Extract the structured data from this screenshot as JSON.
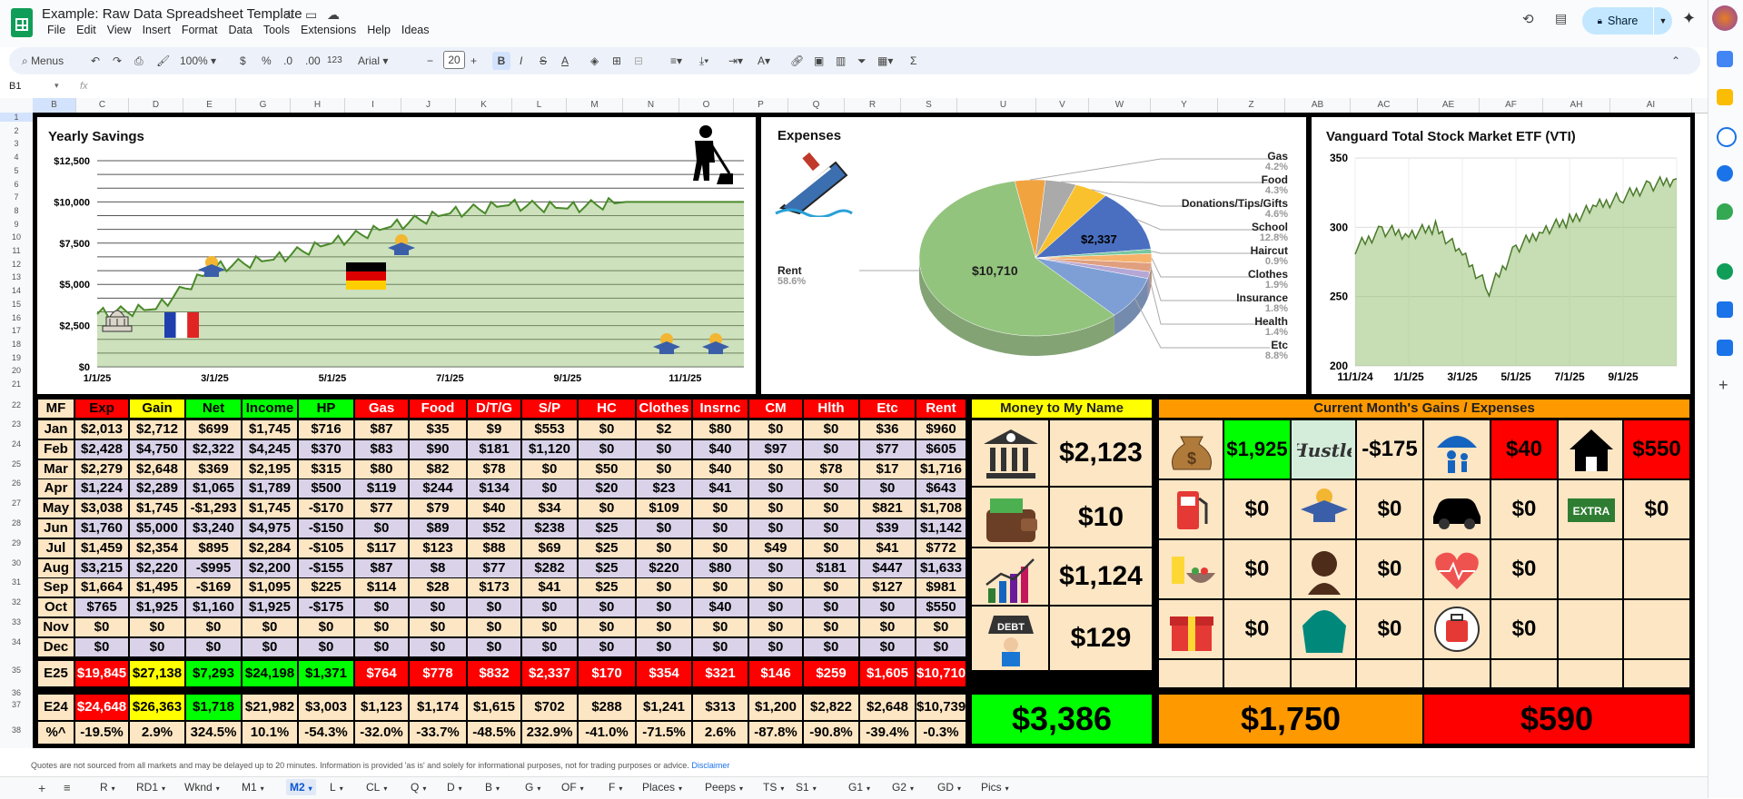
{
  "app": {
    "title": "Example: Raw Data Spreadsheet Template",
    "menus": [
      "File",
      "Edit",
      "View",
      "Insert",
      "Format",
      "Data",
      "Tools",
      "Extensions",
      "Help",
      "Ideas"
    ],
    "share_label": "Share",
    "cell_ref": "B1",
    "fx": "fx"
  },
  "toolbar": {
    "search_label": "Menus",
    "zoom": "100%",
    "currency": "$",
    "percent": "%",
    "dec_less": ".0",
    "dec_more": ".00",
    "num_format": "123",
    "font": "Arial",
    "font_size": "20",
    "bold": "B",
    "italic": "I",
    "strike": "S",
    "text_color": "A"
  },
  "columns": [
    "B",
    "C",
    "D",
    "E",
    "G",
    "H",
    "I",
    "J",
    "K",
    "L",
    "M",
    "N",
    "O",
    "P",
    "Q",
    "R",
    "S",
    "U",
    "V",
    "W",
    "Y",
    "Z",
    "AB",
    "AC",
    "AE",
    "AF",
    "AH",
    "AI"
  ],
  "rows": [
    "1",
    "2",
    "3",
    "4",
    "5",
    "6",
    "7",
    "8",
    "9",
    "10",
    "11",
    "12",
    "13",
    "14",
    "15",
    "16",
    "17",
    "18",
    "19",
    "20",
    "21",
    "22",
    "23",
    "24",
    "25",
    "26",
    "27",
    "28",
    "29",
    "30",
    "31",
    "32",
    "33",
    "34",
    "35",
    "36",
    "37",
    "38"
  ],
  "savings_chart": {
    "title": "Yearly Savings",
    "y_ticks": [
      "$0",
      "$2,500",
      "$5,000",
      "$7,500",
      "$10,000",
      "$12,500"
    ],
    "x_ticks": [
      "1/1/25",
      "3/1/25",
      "5/1/25",
      "7/1/25",
      "9/1/25",
      "11/1/25"
    ]
  },
  "expenses_chart": {
    "title": "Expenses",
    "rent_label": "Rent",
    "rent_pct": "58.6%",
    "rent_value": "$10,710",
    "school_value": "$2,337",
    "legend": [
      {
        "name": "Gas",
        "pct": "4.2%"
      },
      {
        "name": "Food",
        "pct": "4.3%"
      },
      {
        "name": "Donations/Tips/Gifts",
        "pct": "4.6%"
      },
      {
        "name": "School",
        "pct": "12.8%"
      },
      {
        "name": "Haircut",
        "pct": "0.9%"
      },
      {
        "name": "Clothes",
        "pct": "1.9%"
      },
      {
        "name": "Insurance",
        "pct": "1.8%"
      },
      {
        "name": "Health",
        "pct": "1.4%"
      },
      {
        "name": "Etc",
        "pct": "8.8%"
      }
    ]
  },
  "vti_chart": {
    "title": "Vanguard Total Stock Market ETF (VTI)",
    "y_ticks": [
      "200",
      "250",
      "300",
      "350"
    ],
    "x_ticks": [
      "11/1/24",
      "1/1/25",
      "3/1/25",
      "5/1/25",
      "7/1/25",
      "9/1/25"
    ]
  },
  "chart_data": [
    {
      "type": "area",
      "title": "Yearly Savings",
      "x": [
        "1/1/25",
        "2/1/25",
        "3/1/25",
        "4/1/25",
        "5/1/25",
        "6/1/25",
        "7/1/25",
        "8/1/25",
        "9/1/25",
        "10/1/25",
        "11/1/25",
        "12/1/25"
      ],
      "values": [
        3200,
        3500,
        6000,
        6500,
        7500,
        8500,
        9300,
        9800,
        9600,
        10000,
        10000,
        10000
      ],
      "ylim": [
        0,
        12500
      ]
    },
    {
      "type": "pie",
      "title": "Expenses",
      "categories": [
        "Rent",
        "Gas",
        "Food",
        "Donations/Tips/Gifts",
        "School",
        "Haircut",
        "Clothes",
        "Insurance",
        "Health",
        "Etc"
      ],
      "values": [
        58.6,
        4.2,
        4.3,
        4.6,
        12.8,
        0.9,
        1.9,
        1.8,
        1.4,
        8.8
      ]
    },
    {
      "type": "area",
      "title": "Vanguard Total Stock Market ETF (VTI)",
      "x": [
        "11/1/24",
        "12/1/24",
        "1/1/25",
        "2/1/25",
        "3/1/25",
        "4/1/25",
        "5/1/25",
        "6/1/25",
        "7/1/25",
        "8/1/25",
        "9/1/25",
        "10/1/25",
        "11/1/25"
      ],
      "values": [
        285,
        298,
        295,
        300,
        280,
        255,
        285,
        298,
        305,
        315,
        322,
        330,
        335
      ],
      "ylim": [
        200,
        350
      ]
    }
  ],
  "table": {
    "headers": [
      "MF",
      "Exp",
      "Gain",
      "Net",
      "Income",
      "HP",
      "Gas",
      "Food",
      "D/T/G",
      "S/P",
      "HC",
      "Clothes",
      "Insrnc",
      "CM",
      "Hlth",
      "Etc",
      "Rent"
    ],
    "rows": [
      [
        "Jan",
        "$2,013",
        "$2,712",
        "$699",
        "$1,745",
        "$716",
        "$87",
        "$35",
        "$9",
        "$553",
        "$0",
        "$2",
        "$80",
        "$0",
        "$0",
        "$36",
        "$960"
      ],
      [
        "Feb",
        "$2,428",
        "$4,750",
        "$2,322",
        "$4,245",
        "$370",
        "$83",
        "$90",
        "$181",
        "$1,120",
        "$0",
        "$0",
        "$40",
        "$97",
        "$0",
        "$77",
        "$605"
      ],
      [
        "Mar",
        "$2,279",
        "$2,648",
        "$369",
        "$2,195",
        "$315",
        "$80",
        "$82",
        "$78",
        "$0",
        "$50",
        "$0",
        "$40",
        "$0",
        "$78",
        "$17",
        "$1,716"
      ],
      [
        "Apr",
        "$1,224",
        "$2,289",
        "$1,065",
        "$1,789",
        "$500",
        "$119",
        "$244",
        "$134",
        "$0",
        "$20",
        "$23",
        "$41",
        "$0",
        "$0",
        "$0",
        "$643"
      ],
      [
        "May",
        "$3,038",
        "$1,745",
        "-$1,293",
        "$1,745",
        "-$170",
        "$77",
        "$79",
        "$40",
        "$34",
        "$0",
        "$109",
        "$0",
        "$0",
        "$0",
        "$821",
        "$1,708"
      ],
      [
        "Jun",
        "$1,760",
        "$5,000",
        "$3,240",
        "$4,975",
        "-$150",
        "$0",
        "$89",
        "$52",
        "$238",
        "$25",
        "$0",
        "$0",
        "$0",
        "$0",
        "$39",
        "$1,142"
      ],
      [
        "Jul",
        "$1,459",
        "$2,354",
        "$895",
        "$2,284",
        "-$105",
        "$117",
        "$123",
        "$88",
        "$69",
        "$25",
        "$0",
        "$0",
        "$49",
        "$0",
        "$41",
        "$772"
      ],
      [
        "Aug",
        "$3,215",
        "$2,220",
        "-$995",
        "$2,200",
        "-$155",
        "$87",
        "$8",
        "$77",
        "$282",
        "$25",
        "$220",
        "$80",
        "$0",
        "$181",
        "$447",
        "$1,633"
      ],
      [
        "Sep",
        "$1,664",
        "$1,495",
        "-$169",
        "$1,095",
        "$225",
        "$114",
        "$28",
        "$173",
        "$41",
        "$25",
        "$0",
        "$0",
        "$0",
        "$0",
        "$127",
        "$981"
      ],
      [
        "Oct",
        "$765",
        "$1,925",
        "$1,160",
        "$1,925",
        "-$175",
        "$0",
        "$0",
        "$0",
        "$0",
        "$0",
        "$0",
        "$40",
        "$0",
        "$0",
        "$0",
        "$550"
      ],
      [
        "Nov",
        "$0",
        "$0",
        "$0",
        "$0",
        "$0",
        "$0",
        "$0",
        "$0",
        "$0",
        "$0",
        "$0",
        "$0",
        "$0",
        "$0",
        "$0",
        "$0"
      ],
      [
        "Dec",
        "$0",
        "$0",
        "$0",
        "$0",
        "$0",
        "$0",
        "$0",
        "$0",
        "$0",
        "$0",
        "$0",
        "$0",
        "$0",
        "$0",
        "$0",
        "$0"
      ]
    ],
    "e25": [
      "E25",
      "$19,845",
      "$27,138",
      "$7,293",
      "$24,198",
      "$1,371",
      "$764",
      "$778",
      "$832",
      "$2,337",
      "$170",
      "$354",
      "$321",
      "$146",
      "$259",
      "$1,605",
      "$10,710"
    ],
    "e24": [
      "E24",
      "$24,648",
      "$26,363",
      "$1,718",
      "$21,982",
      "$3,003",
      "$1,123",
      "$1,174",
      "$1,615",
      "$702",
      "$288",
      "$1,241",
      "$313",
      "$1,200",
      "$2,822",
      "$2,648",
      "$10,739"
    ],
    "pct": [
      "%^",
      "-19.5%",
      "2.9%",
      "324.5%",
      "10.1%",
      "-54.3%",
      "-32.0%",
      "-33.7%",
      "-48.5%",
      "232.9%",
      "-41.0%",
      "-71.5%",
      "2.6%",
      "-87.8%",
      "-90.8%",
      "-39.4%",
      "-0.3%"
    ]
  },
  "money_panel": {
    "title": "Money to My Name",
    "values": [
      "$2,123",
      "$10",
      "$1,124",
      "$129"
    ],
    "debt_label": "DEBT",
    "total": "$3,386"
  },
  "current_panel": {
    "title": "Current Month's Gains / Expenses",
    "hustle_label": "Hustle",
    "extra_label": "EXTRA",
    "row1": [
      "$1,925",
      "-$175",
      "$40",
      "$550"
    ],
    "row2": [
      "$0",
      "$0",
      "$0",
      "$0"
    ],
    "row3": [
      "$0",
      "$0",
      "$0"
    ],
    "row4": [
      "$0",
      "$0",
      "$0"
    ],
    "gain_total": "$1,750",
    "exp_total": "$590"
  },
  "colors": {
    "red": "#ff0000",
    "yellow": "#ffff00",
    "green": "#00ff00",
    "orange": "#ff9900",
    "cream": "#fde6c4",
    "lavender": "#d9d2e9"
  },
  "footer": {
    "disclaimer": "Quotes are not sourced from all markets and may be delayed up to 20 minutes. Information is provided 'as is' and solely for informational purposes, not for trading purposes or advice.",
    "disclaimer_link": "Disclaimer",
    "tabs": [
      "R",
      "RD1",
      "Wknd",
      "M1",
      "M2",
      "L",
      "CL",
      "Q",
      "D",
      "B",
      "G",
      "OF",
      "F",
      "Places",
      "Peeps",
      "TS",
      "S1",
      "G1",
      "G2",
      "GD",
      "Pics"
    ],
    "active_tab": "M2"
  }
}
